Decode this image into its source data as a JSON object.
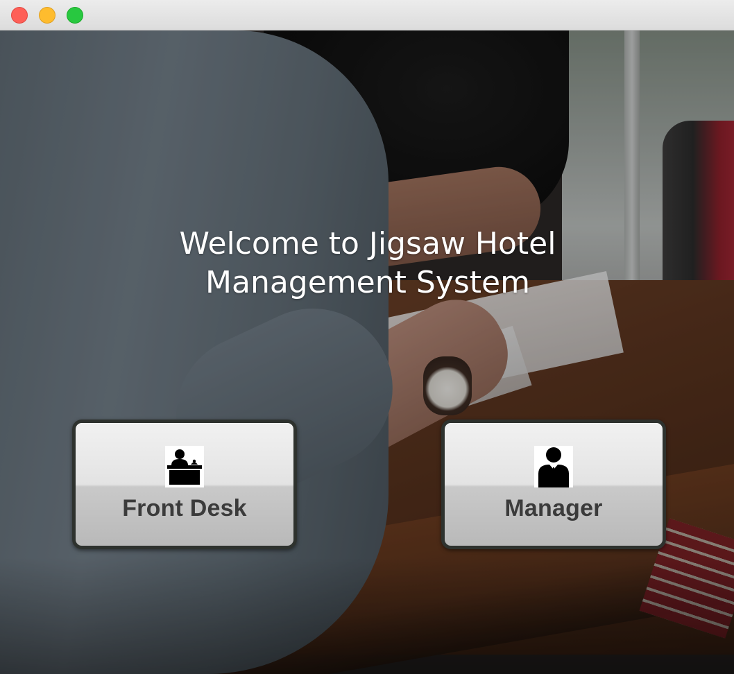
{
  "window": {
    "controls": [
      "close",
      "minimize",
      "maximize"
    ]
  },
  "welcome": {
    "line1": "Welcome to Jigsaw Hotel",
    "line2": "Management System"
  },
  "buttons": {
    "front_desk": {
      "label": "Front Desk",
      "icon": "front-desk-icon"
    },
    "manager": {
      "label": "Manager",
      "icon": "manager-icon"
    }
  },
  "colors": {
    "close": "#fe5f57",
    "minimize": "#febc2e",
    "maximize": "#28c840",
    "button_border": "#2e322e",
    "button_text": "#3b3b3b"
  }
}
